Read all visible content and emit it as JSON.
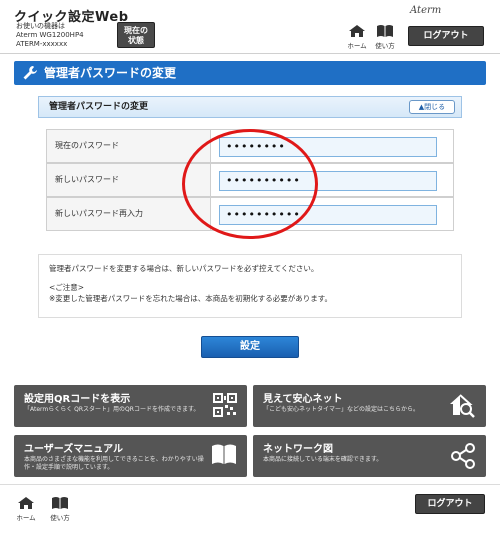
{
  "header": {
    "app_title": "クイック設定Web",
    "device_line1": "お使いの機器は",
    "device_line2": "Aterm WG1200HP4",
    "device_line3": "ATERM-xxxxxx",
    "status_line1": "現在の",
    "status_line2": "状態",
    "home_label": "ホーム",
    "guide_label": "使い方",
    "brand": "Aterm",
    "logout_label": "ログアウト"
  },
  "main": {
    "title": "管理者パスワードの変更",
    "section_title": "管理者パスワードの変更",
    "close_label": "▲閉じる",
    "fields": [
      {
        "label": "現在のパスワード",
        "value": "••••••••"
      },
      {
        "label": "新しいパスワード",
        "value": "••••••••••"
      },
      {
        "label": "新しいパスワード再入力",
        "value": "••••••••••"
      }
    ],
    "note_line1": "管理者パスワードを変更する場合は、新しいパスワードを必ず控えてください。",
    "note_line2": "<ご注意>",
    "note_line3": "※変更した管理者パスワードを忘れた場合は、本商品を初期化する必要があります。",
    "set_label": "設定"
  },
  "tiles": [
    {
      "title": "設定用QRコードを表示",
      "desc": "「Atermらくらく QRスタート」用のQRコードを作成できます。",
      "icon": "qr-code-icon"
    },
    {
      "title": "見えて安心ネット",
      "desc": "「こども安心ネットタイマー」などの設定はこちらから。",
      "icon": "home-search-icon"
    },
    {
      "title": "ユーザーズマニュアル",
      "desc": "本商品のさまざまな機能を利用してできることを、わかりやすい操作・設定手順で説明しています。",
      "icon": "book-icon"
    },
    {
      "title": "ネットワーク図",
      "desc": "本商品に接続している端末を確認できます。",
      "icon": "network-icon"
    }
  ],
  "footer": {
    "home_label": "ホーム",
    "guide_label": "使い方",
    "logout_label": "ログアウト"
  },
  "colors": {
    "accent": "#1f6fc5",
    "tile": "#555555",
    "highlight": "#e01818"
  }
}
